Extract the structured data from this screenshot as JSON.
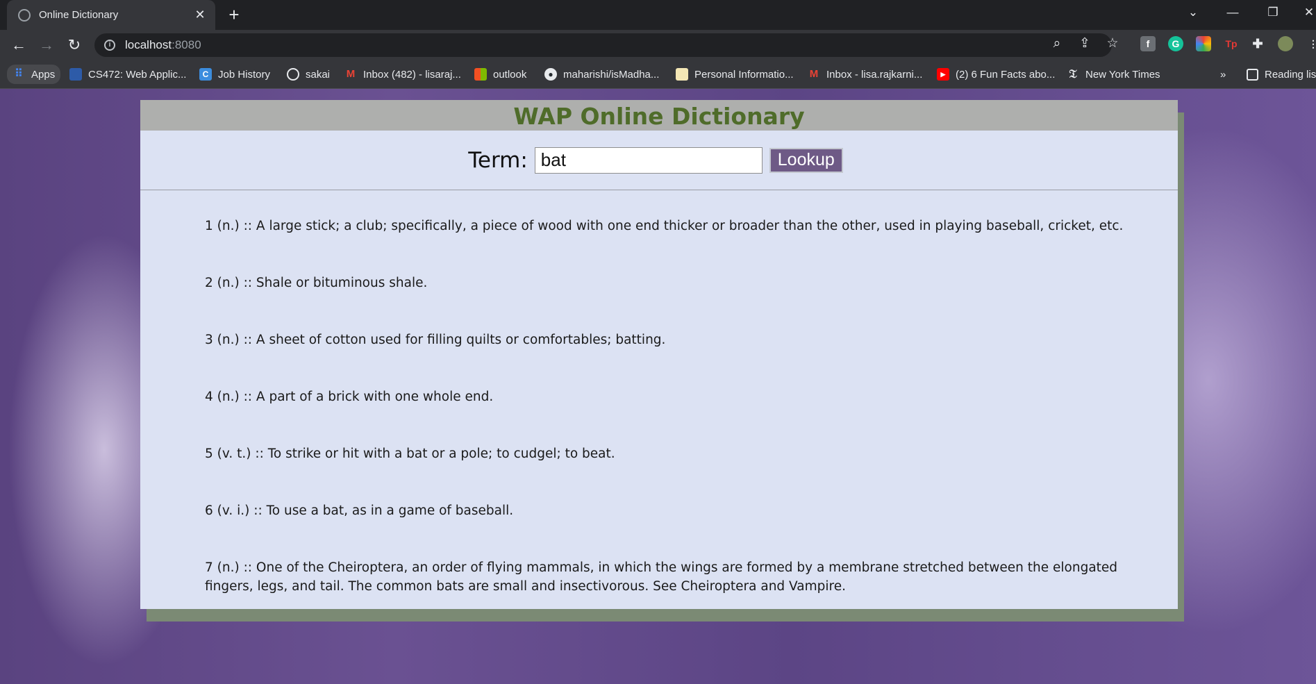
{
  "browser": {
    "tab_title": "Online Dictionary",
    "tab_close": "✕",
    "new_tab": "+",
    "url_host": "localhost",
    "url_port": ":8080",
    "bookmarks": [
      {
        "label": "Apps",
        "icon": "apps-grid-icon",
        "color": "#4285f4"
      },
      {
        "label": "CS472: Web Applic...",
        "icon": "cs472-icon",
        "color": "#2d5ba8"
      },
      {
        "label": "Job History",
        "icon": "job-history-icon",
        "color": "#3c8dde"
      },
      {
        "label": "sakai",
        "icon": "globe-icon",
        "color": "#5f6368"
      },
      {
        "label": "Inbox (482) - lisaraj...",
        "icon": "gmail-icon",
        "color": "#ea4335"
      },
      {
        "label": "outlook",
        "icon": "microsoft-icon",
        "color": "#f25022"
      },
      {
        "label": "maharishi/isMadha...",
        "icon": "github-icon",
        "color": "#24292e"
      },
      {
        "label": "Personal Informatio...",
        "icon": "doc-icon",
        "color": "#f4b400"
      },
      {
        "label": "Inbox - lisa.rajkarni...",
        "icon": "gmail-icon",
        "color": "#ea4335"
      },
      {
        "label": "(2) 6 Fun Facts abo...",
        "icon": "youtube-icon",
        "color": "#ff0000"
      },
      {
        "label": "New York Times",
        "icon": "nyt-icon",
        "color": "#000000"
      }
    ],
    "bookmarks_overflow": "»",
    "reading_list": "Reading lis"
  },
  "app": {
    "title": "WAP Online Dictionary",
    "term_label": "Term:",
    "term_value": "bat",
    "lookup_label": "Lookup",
    "definitions": [
      "1 (n.) :: A large stick; a club; specifically, a piece of wood with one end thicker or broader than the other, used in playing baseball, cricket, etc.",
      "2 (n.) :: Shale or bituminous shale.",
      "3 (n.) :: A sheet of cotton used for filling quilts or comfortables; batting.",
      "4 (n.) :: A part of a brick with one whole end.",
      "5 (v. t.) :: To strike or hit with a bat or a pole; to cudgel; to beat.",
      "6 (v. i.) :: To use a bat, as in a game of baseball.",
      "7 (n.) :: One of the Cheiroptera, an order of flying mammals, in which the wings are formed by a membrane stretched between the elongated fingers, legs, and tail. The common bats are small and insectivorous. See Cheiroptera and Vampire."
    ]
  },
  "colors": {
    "header_text": "#4f6c2a",
    "card_bg": "#dce2f3",
    "button_bg": "#6e5a86",
    "page_bg": "#5e4685"
  }
}
